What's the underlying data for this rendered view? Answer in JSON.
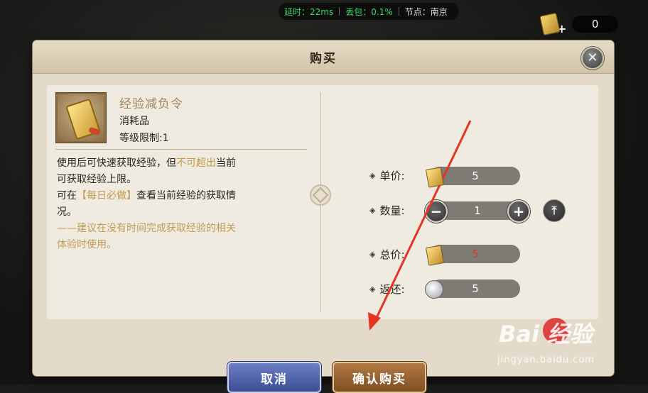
{
  "status": {
    "latency_label": "延时：",
    "latency_value": "22ms",
    "loss_label": "丢包：",
    "loss_value": "0.1%",
    "node_label": "节点：",
    "node_value": "南京"
  },
  "currency_top": {
    "icon": "token-scroll-icon",
    "add_symbol": "+",
    "amount": "0"
  },
  "dialog": {
    "title": "购买",
    "close_icon": "close-icon"
  },
  "item": {
    "name": "经验减负令",
    "type": "消耗品",
    "level_label": "等级限制:",
    "level_value": "1",
    "desc_1a": "使用后可快速获取经验，但",
    "desc_1b": "不可超出",
    "desc_1c": "当前",
    "desc_2": "可获取经验上限。",
    "desc_3a": "可在",
    "desc_3b": "【每日必做】",
    "desc_3c": "查看当前经验的获取情",
    "desc_4": "况。",
    "desc_5": "——建议在没有时间完成获取经验的相关",
    "desc_6": "体验时使用。"
  },
  "purchase": {
    "unit_price_label": "单价:",
    "unit_price_value": "5",
    "quantity_label": "数量:",
    "quantity_value": "1",
    "minus_symbol": "−",
    "plus_symbol": "+",
    "max_symbol": "⤒",
    "total_label": "总价:",
    "total_value": "5",
    "refund_label": "返还:",
    "refund_value": "5",
    "bullet": "◈"
  },
  "buttons": {
    "cancel": "取消",
    "confirm": "确认购买"
  },
  "watermark": {
    "main": "Bai  经验",
    "sub": "jingyan.baidu.com"
  },
  "colors": {
    "gold_text": "#a0855b",
    "highlight": "#c49a4c",
    "total_red": "#d43a2a",
    "cancel_blue": "#3c4d95",
    "confirm_brown": "#7e4e22",
    "arrow_red": "#e53422"
  }
}
